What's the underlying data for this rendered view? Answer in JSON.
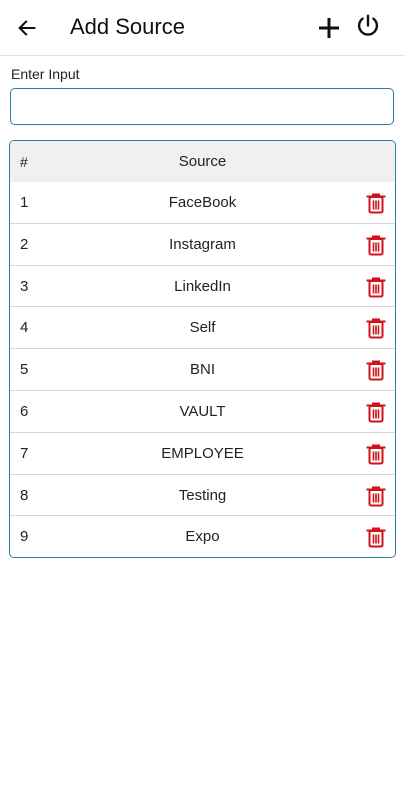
{
  "header": {
    "title": "Add Source",
    "back_icon": "arrow-left-icon",
    "add_icon": "plus-icon",
    "power_icon": "power-icon"
  },
  "form": {
    "label": "Enter Input",
    "value": "",
    "placeholder": ""
  },
  "table": {
    "columns": [
      "#",
      "Source"
    ],
    "rows": [
      {
        "num": "1",
        "source": "FaceBook"
      },
      {
        "num": "2",
        "source": "Instagram"
      },
      {
        "num": "3",
        "source": "LinkedIn"
      },
      {
        "num": "4",
        "source": "Self"
      },
      {
        "num": "5",
        "source": "BNI"
      },
      {
        "num": "6",
        "source": "VAULT"
      },
      {
        "num": "7",
        "source": "EMPLOYEE"
      },
      {
        "num": "8",
        "source": "Testing"
      },
      {
        "num": "9",
        "source": "Expo"
      }
    ],
    "delete_icon": "trash-icon"
  },
  "colors": {
    "accent": "#2d7ea4",
    "delete": "#d0121b",
    "header_bg": "#f0f0f0"
  }
}
